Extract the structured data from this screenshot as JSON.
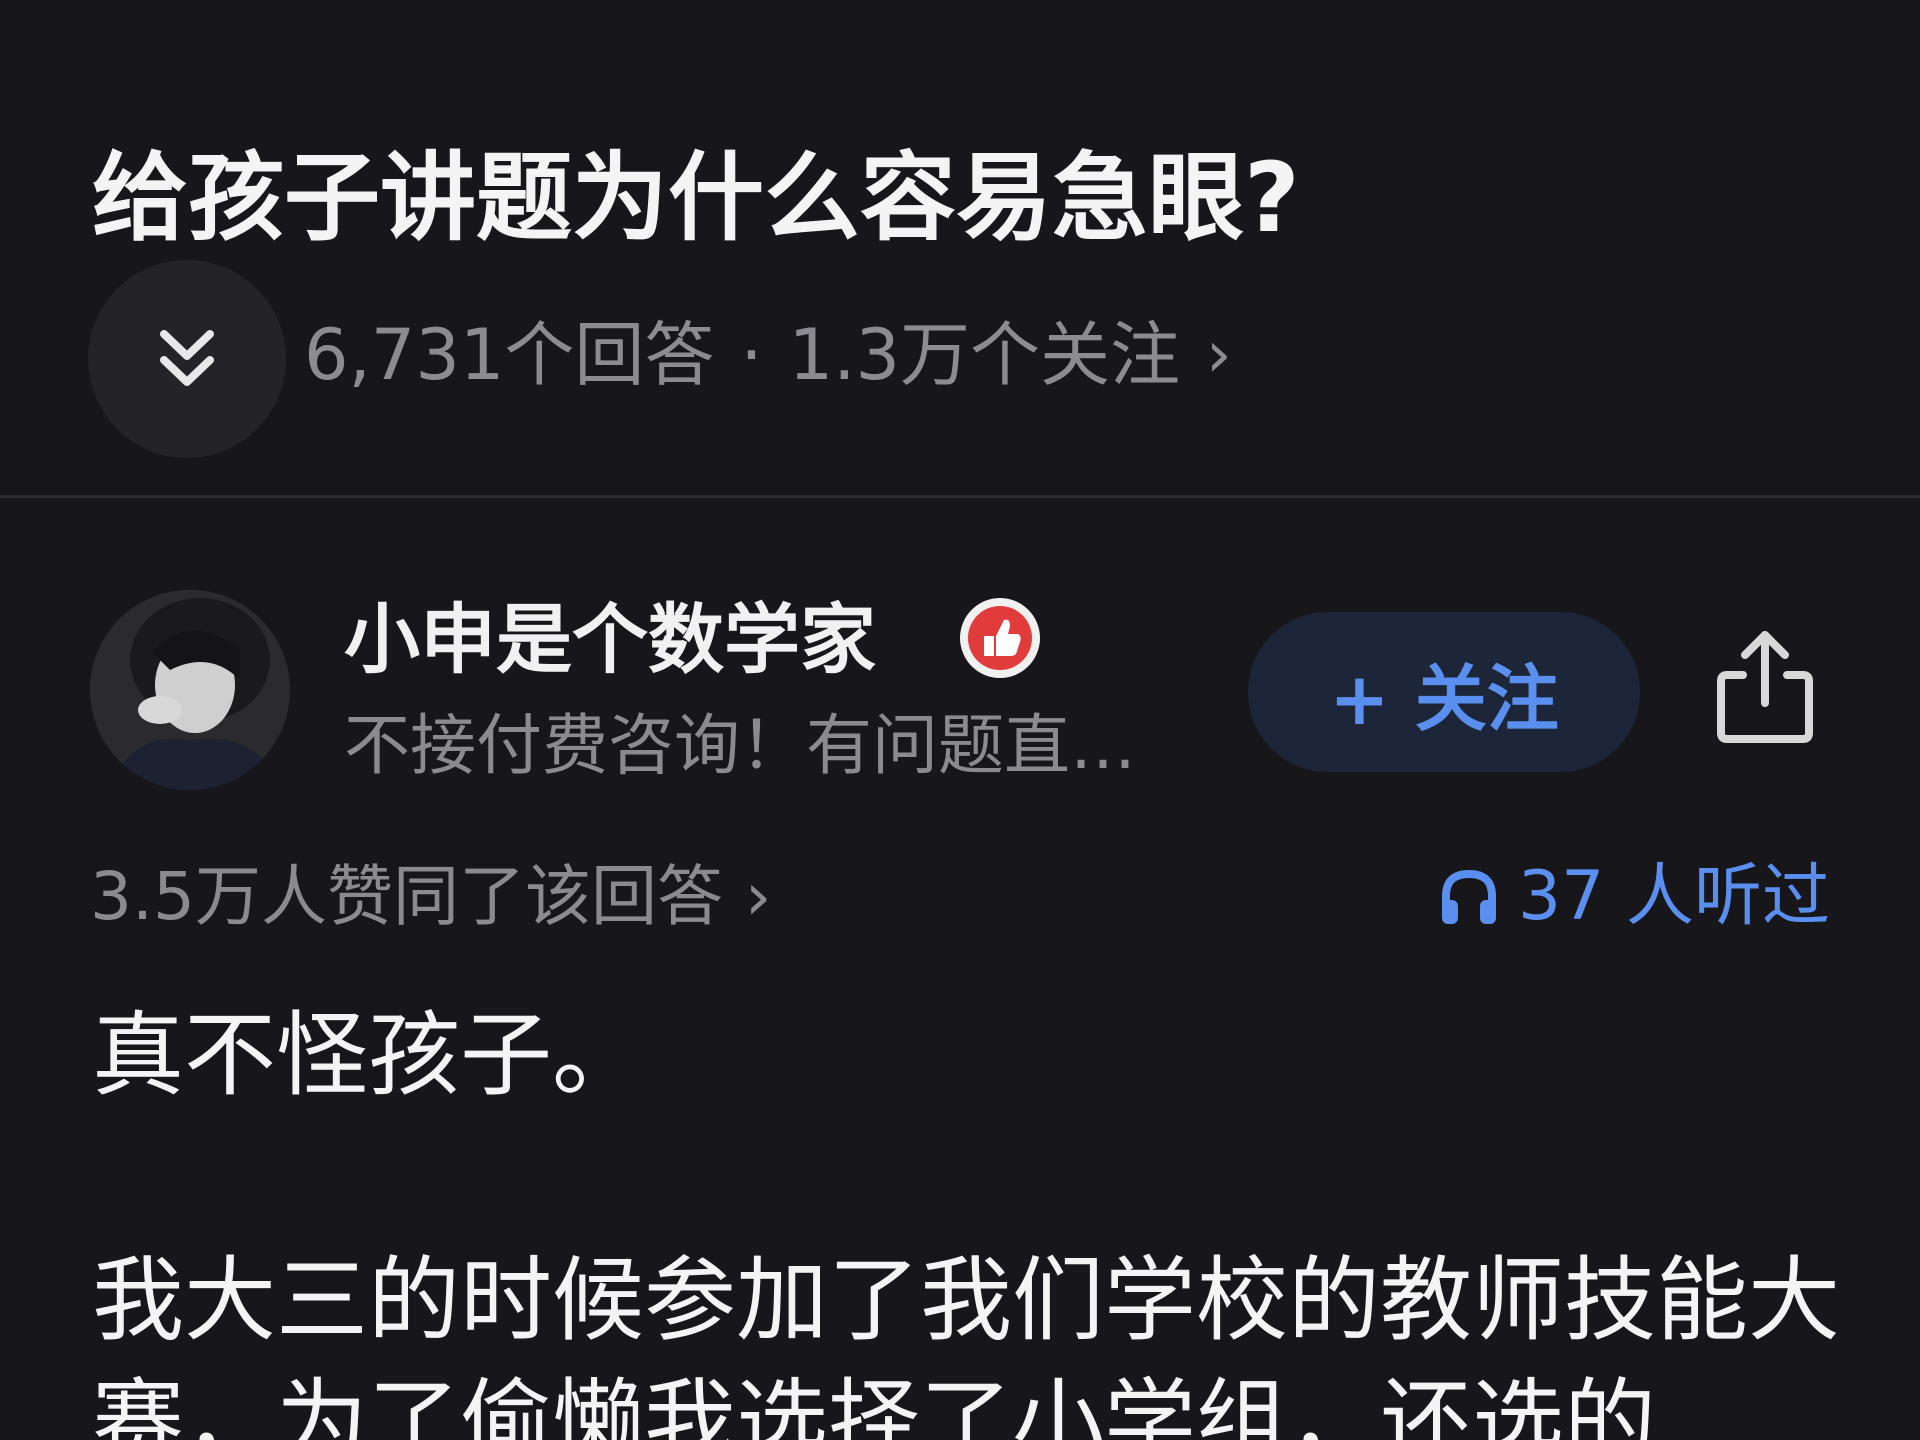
{
  "question": {
    "title": "给孩子讲题为什么容易急眼?",
    "answers_count": "6,731个回答",
    "separator": "·",
    "followers_count": "1.3万个关注",
    "meta_chevron": "›"
  },
  "author": {
    "name": "小申是个数学家",
    "bio": "不接付费咨询！有问题直…",
    "follow_label": "+ 关注"
  },
  "stats": {
    "approvals": "3.5万人赞同了该回答",
    "approvals_chevron": "›",
    "listened": "37 人听过"
  },
  "answer": {
    "paragraph1": "真不怪孩子。",
    "paragraph2": "我大三的时候参加了我们学校的教师技能大赛，为了偷懒我选择了小学组，还选的"
  },
  "colors": {
    "background": "#17171b",
    "accent": "#5a8ff0",
    "secondary_text": "#8a8a90",
    "badge": "#e23b3b"
  },
  "icons": {
    "collapse": "double-chevron-down-icon",
    "badge": "thumbs-up-badge-icon",
    "share": "share-icon",
    "listen": "headphones-icon"
  }
}
